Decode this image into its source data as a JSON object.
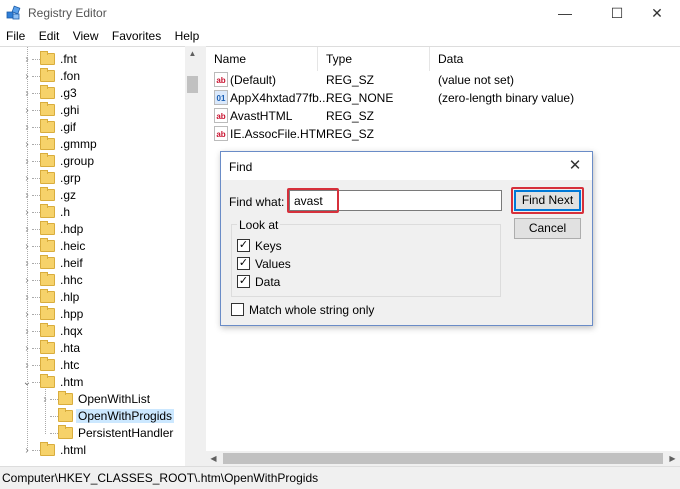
{
  "window": {
    "title": "Registry Editor",
    "minimize": "—",
    "maximize": "☐",
    "close": "✕"
  },
  "menu": [
    "File",
    "Edit",
    "View",
    "Favorites",
    "Help"
  ],
  "tree": {
    "items": [
      {
        "label": ".fnt",
        "expandable": true,
        "expanded": false,
        "level": 0
      },
      {
        "label": ".fon",
        "expandable": true,
        "expanded": false,
        "level": 0
      },
      {
        "label": ".g3",
        "expandable": true,
        "expanded": false,
        "level": 0
      },
      {
        "label": ".ghi",
        "expandable": true,
        "expanded": false,
        "level": 0
      },
      {
        "label": ".gif",
        "expandable": true,
        "expanded": false,
        "level": 0
      },
      {
        "label": ".gmmp",
        "expandable": true,
        "expanded": false,
        "level": 0
      },
      {
        "label": ".group",
        "expandable": true,
        "expanded": false,
        "level": 0
      },
      {
        "label": ".grp",
        "expandable": true,
        "expanded": false,
        "level": 0
      },
      {
        "label": ".gz",
        "expandable": true,
        "expanded": false,
        "level": 0
      },
      {
        "label": ".h",
        "expandable": true,
        "expanded": false,
        "level": 0
      },
      {
        "label": ".hdp",
        "expandable": true,
        "expanded": false,
        "level": 0
      },
      {
        "label": ".heic",
        "expandable": true,
        "expanded": false,
        "level": 0
      },
      {
        "label": ".heif",
        "expandable": true,
        "expanded": false,
        "level": 0
      },
      {
        "label": ".hhc",
        "expandable": true,
        "expanded": false,
        "level": 0
      },
      {
        "label": ".hlp",
        "expandable": true,
        "expanded": false,
        "level": 0
      },
      {
        "label": ".hpp",
        "expandable": true,
        "expanded": false,
        "level": 0
      },
      {
        "label": ".hqx",
        "expandable": true,
        "expanded": false,
        "level": 0
      },
      {
        "label": ".hta",
        "expandable": true,
        "expanded": false,
        "level": 0
      },
      {
        "label": ".htc",
        "expandable": true,
        "expanded": false,
        "level": 0
      },
      {
        "label": ".htm",
        "expandable": true,
        "expanded": true,
        "level": 0
      },
      {
        "label": "OpenWithList",
        "expandable": true,
        "expanded": false,
        "level": 1
      },
      {
        "label": "OpenWithProgids",
        "expandable": false,
        "expanded": false,
        "level": 1,
        "selected": true
      },
      {
        "label": "PersistentHandler",
        "expandable": false,
        "expanded": false,
        "level": 1
      },
      {
        "label": ".html",
        "expandable": true,
        "expanded": false,
        "level": 0
      }
    ]
  },
  "list": {
    "columns": [
      "Name",
      "Type",
      "Data"
    ],
    "rows": [
      {
        "icon": "string-value-icon",
        "name": "(Default)",
        "type": "REG_SZ",
        "data": "(value not set)"
      },
      {
        "icon": "binary-value-icon",
        "name": "AppX4hxtad77fb...",
        "type": "REG_NONE",
        "data": "(zero-length binary value)"
      },
      {
        "icon": "string-value-icon",
        "name": "AvastHTML",
        "type": "REG_SZ",
        "data": ""
      },
      {
        "icon": "string-value-icon",
        "name": "IE.AssocFile.HTM",
        "type": "REG_SZ",
        "data": ""
      }
    ]
  },
  "status": "Computer\\HKEY_CLASSES_ROOT\\.htm\\OpenWithProgids",
  "find_dialog": {
    "title": "Find",
    "close": "✕",
    "find_label": "Find what:",
    "find_value": "avast",
    "find_next": "Find Next",
    "cancel": "Cancel",
    "look_at_label": "Look at",
    "options": [
      {
        "label": "Keys",
        "checked": true
      },
      {
        "label": "Values",
        "checked": true
      },
      {
        "label": "Data",
        "checked": true
      }
    ],
    "match_whole": {
      "label": "Match whole string only",
      "checked": false
    },
    "highlight_color": "#d6303b"
  }
}
